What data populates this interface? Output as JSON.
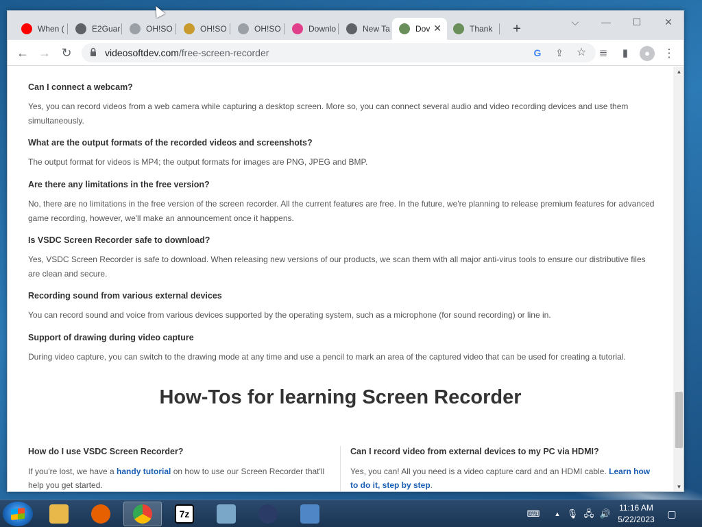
{
  "browser": {
    "tabs": [
      {
        "label": "When (",
        "icon": "youtube-icon",
        "color": "#ff0000"
      },
      {
        "label": "E2Guar",
        "icon": "globe-icon",
        "color": "#5f6368"
      },
      {
        "label": "OH!SO",
        "icon": "ohsoft-icon",
        "color": "#9aa0a6"
      },
      {
        "label": "OH!SO",
        "icon": "ohsoft-folder-icon",
        "color": "#c99a2e"
      },
      {
        "label": "OH!SO",
        "icon": "ohsoft-icon",
        "color": "#9aa0a6"
      },
      {
        "label": "Downlo",
        "icon": "pinwheel-icon",
        "color": "#e0408a"
      },
      {
        "label": "New Ta",
        "icon": "chrome-icon",
        "color": "#5f6368"
      },
      {
        "label": "Dov",
        "icon": "vsdc-icon",
        "color": "#6a8f5a",
        "active": true
      },
      {
        "label": "Thank",
        "icon": "vsdc-icon",
        "color": "#6a8f5a"
      }
    ],
    "new_tab": "+",
    "tab_close": "✕",
    "window_controls": {
      "dropdown": "⌵",
      "minimize": "—",
      "maximize": "☐",
      "close": "✕"
    },
    "nav": {
      "back": "←",
      "forward": "→",
      "reload": "↻"
    },
    "address": {
      "domain": "videosoftdev.com",
      "path": "/free-screen-recorder"
    },
    "omnibox_icons": {
      "google": "G",
      "share": "⇪",
      "bookmark": "☆"
    },
    "toolbar_icons": {
      "media": "≣",
      "sidepanel": "▮",
      "profile": "●",
      "menu": "⋮"
    }
  },
  "faq": [
    {
      "q": "Can I connect a webcam?",
      "a": "Yes, you can record videos from a web camera while capturing a desktop screen. More so, you can connect several audio and video recording devices and use them simultaneously."
    },
    {
      "q": "What are the output formats of the recorded videos and screenshots?",
      "a": "The output format for videos is MP4; the output formats for images are PNG, JPEG and BMP."
    },
    {
      "q": "Are there any limitations in the free version?",
      "a": "No, there are no limitations in the free version of the screen recorder. All the current features are free. In the future, we're planning to release premium features for advanced game recording, however, we'll make an announcement once it happens."
    },
    {
      "q": "Is VSDC Screen Recorder safe to download?",
      "a": "Yes, VSDC Screen Recorder is safe to download. When releasing new versions of our products, we scan them with all major anti-virus tools to ensure our distributive files are clean and secure."
    },
    {
      "q": "Recording sound from various external devices",
      "a": "You can record sound and voice from various devices supported by the operating system, such as a microphone (for sound recording) or line in."
    },
    {
      "q": "Support of drawing during video capture",
      "a": "During video capture, you can switch to the drawing mode at any time and use a pencil to mark an area of the captured video that can be used for creating a tutorial."
    }
  ],
  "howtos": {
    "title": "How-Tos for learning Screen Recorder",
    "left": {
      "q": "How do I use VSDC Screen Recorder?",
      "a_before": "If you're lost, we have a ",
      "link": "handy tutorial",
      "a_after": " on how to use our Screen Recorder that'll help you get started."
    },
    "right": {
      "q": "Can I record video from external devices to my PC via HDMI?",
      "a_before": "Yes, you can! All you need is a video capture card and an HDMI cable. ",
      "link": "Learn how to do it, step by step",
      "a_after": "."
    }
  },
  "scrollbar": {
    "up": "▲",
    "down": "▼"
  },
  "taskbar": {
    "apps": [
      {
        "name": "file-explorer-icon",
        "color": "#e8b84a"
      },
      {
        "name": "firefox-icon",
        "color": "#e66000"
      },
      {
        "name": "chrome-icon",
        "color": "#4285f4",
        "active": true
      },
      {
        "name": "7zip-icon",
        "label": "7z",
        "color": "#000000"
      },
      {
        "name": "task-manager-icon",
        "color": "#7aa7c7"
      },
      {
        "name": "ohsoft-app-icon",
        "color": "#2a3c66"
      },
      {
        "name": "window-app-icon",
        "color": "#4f86c6"
      }
    ],
    "tray": {
      "keyboard": "⌨",
      "arrow": "▲",
      "mic": "🎙",
      "network": "🖧",
      "volume": "🔊"
    },
    "time": "11:16 AM",
    "date": "5/22/2023",
    "show_desktop": "▢"
  }
}
